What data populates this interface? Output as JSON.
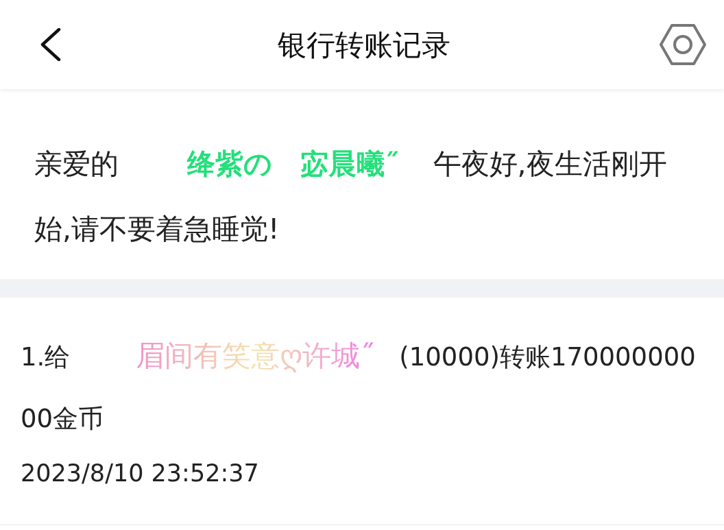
{
  "header": {
    "title": "银行转账记录"
  },
  "greeting": {
    "prefix": "亲爱的",
    "name": "绛紫の　宓晨曦˝",
    "message": "午夜好,夜生活刚开始,请不要着急睡觉!"
  },
  "records": [
    {
      "index": "1.给",
      "recipient": "眉间有笑意ღ许城˝",
      "detail": "(10000)转账17000000000金币",
      "time": "2023/8/10 23:52:37"
    }
  ]
}
